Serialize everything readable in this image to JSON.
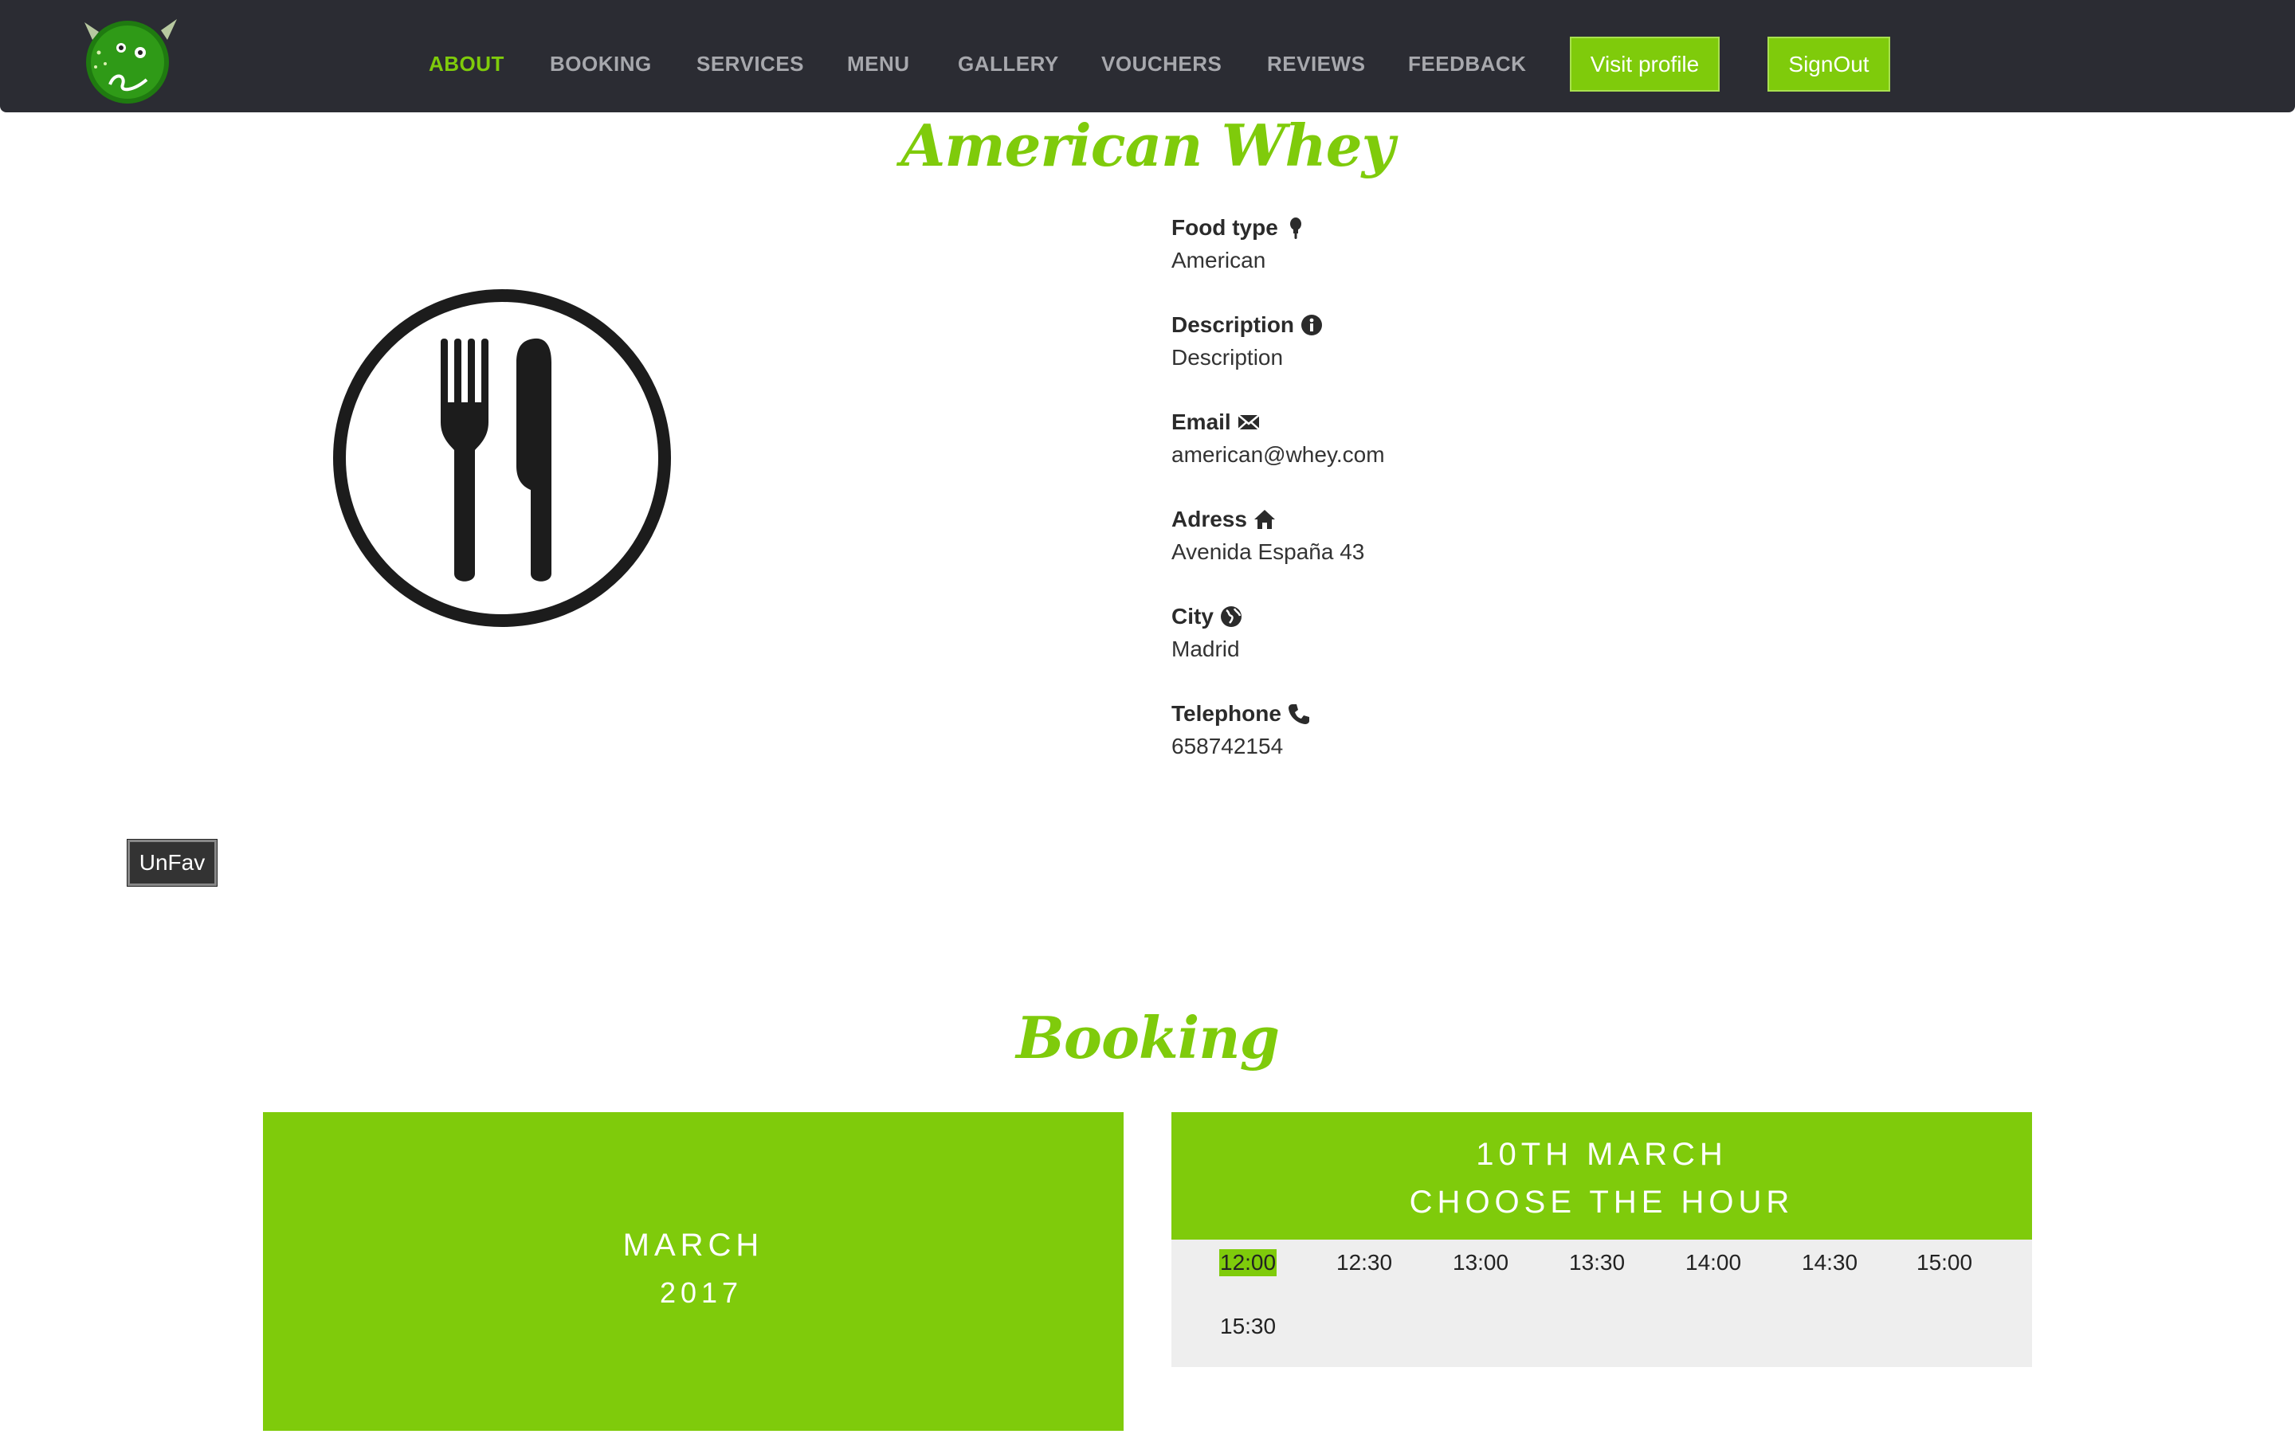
{
  "nav": {
    "links": [
      "ABOUT",
      "BOOKING",
      "SERVICES",
      "MENU",
      "GALLERY",
      "VOUCHERS",
      "REVIEWS",
      "FEEDBACK"
    ],
    "active": "ABOUT",
    "visit_profile_label": "Visit profile",
    "signout_label": "SignOut"
  },
  "restaurant": {
    "name": "American Whey",
    "info": [
      {
        "label": "Food type",
        "icon": "ice-cream-icon",
        "value": "American"
      },
      {
        "label": "Description",
        "icon": "info-icon",
        "value": "Description"
      },
      {
        "label": "Email",
        "icon": "envelope-icon",
        "value": "american@whey.com"
      },
      {
        "label": "Adress",
        "icon": "home-icon",
        "value": "Avenida España 43"
      },
      {
        "label": "City",
        "icon": "globe-icon",
        "value": "Madrid"
      },
      {
        "label": "Telephone",
        "icon": "phone-icon",
        "value": "658742154"
      }
    ],
    "unfav_label": "UnFav"
  },
  "booking": {
    "title": "Booking",
    "calendar": {
      "month": "MARCH",
      "year": "2017"
    },
    "hours": {
      "day": "10TH MARCH",
      "prompt": "CHOOSE THE HOUR",
      "slots": [
        "12:00",
        "12:30",
        "13:00",
        "13:30",
        "14:00",
        "14:30",
        "15:00",
        "15:30"
      ],
      "selected": "12:00"
    }
  },
  "colors": {
    "accent": "#7fcb0b",
    "navbar": "#2b2c33",
    "nav_text": "#a7a8ad",
    "panel_bg": "#eeeeee"
  }
}
